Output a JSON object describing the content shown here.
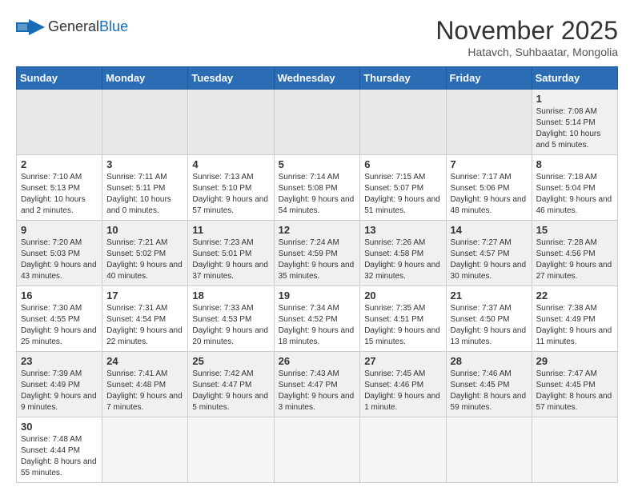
{
  "header": {
    "logo_general": "General",
    "logo_blue": "Blue",
    "month_title": "November 2025",
    "subtitle": "Hatavch, Suhbaatar, Mongolia"
  },
  "weekdays": [
    "Sunday",
    "Monday",
    "Tuesday",
    "Wednesday",
    "Thursday",
    "Friday",
    "Saturday"
  ],
  "weeks": [
    [
      {
        "day": "",
        "info": ""
      },
      {
        "day": "",
        "info": ""
      },
      {
        "day": "",
        "info": ""
      },
      {
        "day": "",
        "info": ""
      },
      {
        "day": "",
        "info": ""
      },
      {
        "day": "",
        "info": ""
      },
      {
        "day": "1",
        "info": "Sunrise: 7:08 AM\nSunset: 5:14 PM\nDaylight: 10 hours and 5 minutes."
      }
    ],
    [
      {
        "day": "2",
        "info": "Sunrise: 7:10 AM\nSunset: 5:13 PM\nDaylight: 10 hours and 2 minutes."
      },
      {
        "day": "3",
        "info": "Sunrise: 7:11 AM\nSunset: 5:11 PM\nDaylight: 10 hours and 0 minutes."
      },
      {
        "day": "4",
        "info": "Sunrise: 7:13 AM\nSunset: 5:10 PM\nDaylight: 9 hours and 57 minutes."
      },
      {
        "day": "5",
        "info": "Sunrise: 7:14 AM\nSunset: 5:08 PM\nDaylight: 9 hours and 54 minutes."
      },
      {
        "day": "6",
        "info": "Sunrise: 7:15 AM\nSunset: 5:07 PM\nDaylight: 9 hours and 51 minutes."
      },
      {
        "day": "7",
        "info": "Sunrise: 7:17 AM\nSunset: 5:06 PM\nDaylight: 9 hours and 48 minutes."
      },
      {
        "day": "8",
        "info": "Sunrise: 7:18 AM\nSunset: 5:04 PM\nDaylight: 9 hours and 46 minutes."
      }
    ],
    [
      {
        "day": "9",
        "info": "Sunrise: 7:20 AM\nSunset: 5:03 PM\nDaylight: 9 hours and 43 minutes."
      },
      {
        "day": "10",
        "info": "Sunrise: 7:21 AM\nSunset: 5:02 PM\nDaylight: 9 hours and 40 minutes."
      },
      {
        "day": "11",
        "info": "Sunrise: 7:23 AM\nSunset: 5:01 PM\nDaylight: 9 hours and 37 minutes."
      },
      {
        "day": "12",
        "info": "Sunrise: 7:24 AM\nSunset: 4:59 PM\nDaylight: 9 hours and 35 minutes."
      },
      {
        "day": "13",
        "info": "Sunrise: 7:26 AM\nSunset: 4:58 PM\nDaylight: 9 hours and 32 minutes."
      },
      {
        "day": "14",
        "info": "Sunrise: 7:27 AM\nSunset: 4:57 PM\nDaylight: 9 hours and 30 minutes."
      },
      {
        "day": "15",
        "info": "Sunrise: 7:28 AM\nSunset: 4:56 PM\nDaylight: 9 hours and 27 minutes."
      }
    ],
    [
      {
        "day": "16",
        "info": "Sunrise: 7:30 AM\nSunset: 4:55 PM\nDaylight: 9 hours and 25 minutes."
      },
      {
        "day": "17",
        "info": "Sunrise: 7:31 AM\nSunset: 4:54 PM\nDaylight: 9 hours and 22 minutes."
      },
      {
        "day": "18",
        "info": "Sunrise: 7:33 AM\nSunset: 4:53 PM\nDaylight: 9 hours and 20 minutes."
      },
      {
        "day": "19",
        "info": "Sunrise: 7:34 AM\nSunset: 4:52 PM\nDaylight: 9 hours and 18 minutes."
      },
      {
        "day": "20",
        "info": "Sunrise: 7:35 AM\nSunset: 4:51 PM\nDaylight: 9 hours and 15 minutes."
      },
      {
        "day": "21",
        "info": "Sunrise: 7:37 AM\nSunset: 4:50 PM\nDaylight: 9 hours and 13 minutes."
      },
      {
        "day": "22",
        "info": "Sunrise: 7:38 AM\nSunset: 4:49 PM\nDaylight: 9 hours and 11 minutes."
      }
    ],
    [
      {
        "day": "23",
        "info": "Sunrise: 7:39 AM\nSunset: 4:49 PM\nDaylight: 9 hours and 9 minutes."
      },
      {
        "day": "24",
        "info": "Sunrise: 7:41 AM\nSunset: 4:48 PM\nDaylight: 9 hours and 7 minutes."
      },
      {
        "day": "25",
        "info": "Sunrise: 7:42 AM\nSunset: 4:47 PM\nDaylight: 9 hours and 5 minutes."
      },
      {
        "day": "26",
        "info": "Sunrise: 7:43 AM\nSunset: 4:47 PM\nDaylight: 9 hours and 3 minutes."
      },
      {
        "day": "27",
        "info": "Sunrise: 7:45 AM\nSunset: 4:46 PM\nDaylight: 9 hours and 1 minute."
      },
      {
        "day": "28",
        "info": "Sunrise: 7:46 AM\nSunset: 4:45 PM\nDaylight: 8 hours and 59 minutes."
      },
      {
        "day": "29",
        "info": "Sunrise: 7:47 AM\nSunset: 4:45 PM\nDaylight: 8 hours and 57 minutes."
      }
    ],
    [
      {
        "day": "30",
        "info": "Sunrise: 7:48 AM\nSunset: 4:44 PM\nDaylight: 8 hours and 55 minutes."
      },
      {
        "day": "",
        "info": ""
      },
      {
        "day": "",
        "info": ""
      },
      {
        "day": "",
        "info": ""
      },
      {
        "day": "",
        "info": ""
      },
      {
        "day": "",
        "info": ""
      },
      {
        "day": "",
        "info": ""
      }
    ]
  ]
}
